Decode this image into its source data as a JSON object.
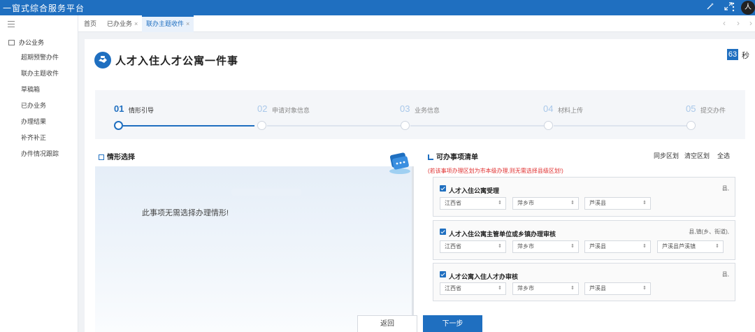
{
  "app": {
    "title": "一窗式综合服务平台",
    "avatar_text": "人"
  },
  "topbar": {
    "icons": [
      "wand-icon",
      "expand-icon",
      "more-icon"
    ],
    "accent": "#1f6fc0"
  },
  "sidebar": {
    "group": "办公业务",
    "items": [
      "超期预警办件",
      "联办主题收件",
      "草稿箱",
      "已办业务",
      "办理结果",
      "补齐补正",
      "办件情况跟踪"
    ]
  },
  "tabs": [
    {
      "label": "首页"
    },
    {
      "label": "已办业务",
      "close": "×"
    },
    {
      "label": "联办主题收件",
      "close": "×"
    }
  ],
  "tab_nav": {
    "prev": "‹",
    "next": "›",
    "more": "›"
  },
  "page": {
    "title": "人才入住人才公寓一件事",
    "timer": "63",
    "timer_unit": "秒"
  },
  "steps": [
    {
      "num": "01",
      "label": "情形引导"
    },
    {
      "num": "02",
      "label": "申请对象信息"
    },
    {
      "num": "03",
      "label": "业务信息"
    },
    {
      "num": "04",
      "label": "材料上传"
    },
    {
      "num": "05",
      "label": "提交办件"
    }
  ],
  "situation": {
    "title": "情形选择",
    "message": "此事项无需选择办理情形!"
  },
  "checklist": {
    "title": "可办事项清单",
    "actions": [
      "同步区划",
      "清空区划",
      "全选"
    ],
    "notice": "(若该事项办理区划为市本级办理,则无需选择县级区划!)",
    "items": [
      {
        "title": "人才入住公寓受理",
        "level": "县,",
        "selects": [
          "江西省",
          "萍乡市",
          "芦溪县"
        ]
      },
      {
        "title": "人才入住公寓主管单位或乡镇办理审核",
        "level": "县,镇(乡、街道),",
        "selects": [
          "江西省",
          "萍乡市",
          "芦溪县",
          "芦溪县芦溪镇"
        ]
      },
      {
        "title": "人才公寓入住人才办审核",
        "level": "县,",
        "selects": [
          "江西省",
          "萍乡市",
          "芦溪县"
        ]
      }
    ],
    "select_arrow": "⇕"
  },
  "buttons": {
    "back": "返回",
    "next": "下一步"
  }
}
